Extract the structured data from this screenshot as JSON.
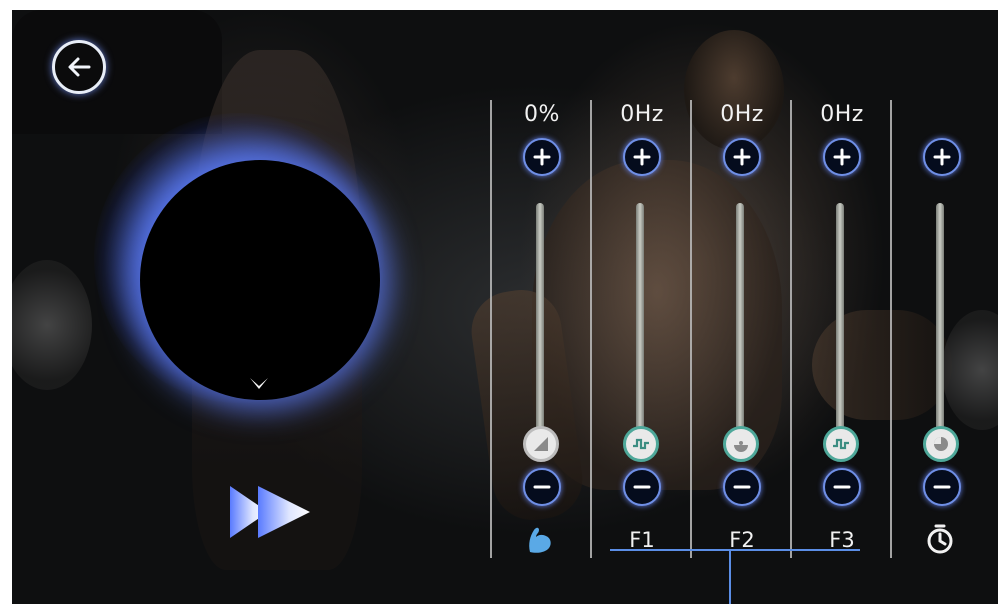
{
  "header": {
    "back_icon": "arrow-left-circle-icon"
  },
  "dial": {
    "indicator_icon": "chevron-down-icon",
    "play_icon": "fast-forward-icon"
  },
  "controls": [
    {
      "id": "intensity",
      "value": "0%",
      "label": "",
      "label_icon": "flexed-arm-icon",
      "thumb_icon": "ramp-icon",
      "level": 0
    },
    {
      "id": "f1",
      "value": "0Hz",
      "label": "F1",
      "label_icon": "",
      "thumb_icon": "pulse-wave-icon",
      "level": 0
    },
    {
      "id": "f2",
      "value": "0Hz",
      "label": "F2",
      "label_icon": "",
      "thumb_icon": "gauge-icon",
      "level": 0
    },
    {
      "id": "f3",
      "value": "0Hz",
      "label": "F3",
      "label_icon": "",
      "thumb_icon": "pulse-wave-icon",
      "level": 0
    },
    {
      "id": "timer",
      "value": "",
      "label": "",
      "label_icon": "stopwatch-icon",
      "thumb_icon": "timer-pie-icon",
      "level": 0
    }
  ],
  "colors": {
    "accent": "#6f8fe6",
    "thumb_ring": "#4ea89a",
    "glow": "#5a78e0"
  }
}
